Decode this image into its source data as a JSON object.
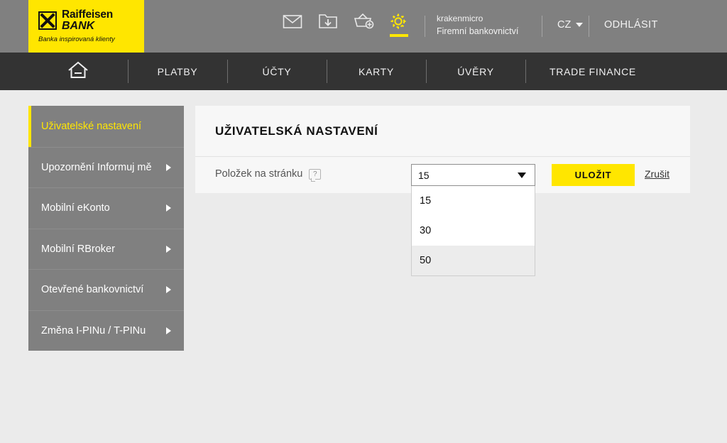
{
  "brand": {
    "logo_line1": "Raiffeisen",
    "logo_line2": "BANK",
    "tagline": "Banka inspirovaná klienty",
    "yellow": "#ffe600",
    "header_gray": "#808080",
    "nav_dark": "#333333",
    "page_bg": "#ebebeb"
  },
  "header": {
    "icons": [
      {
        "name": "mail-icon",
        "label": "Zprávy"
      },
      {
        "name": "download-folder-icon",
        "label": "Ke stažení"
      },
      {
        "name": "basket-add-icon",
        "label": "Koš"
      },
      {
        "name": "gear-icon",
        "label": "Nastavení",
        "active": true
      }
    ],
    "user_name": "krakenmicro",
    "user_segment": "Firemní bankovnictví",
    "language": "CZ",
    "logout": "ODHLÁSIT"
  },
  "nav": {
    "home_icon": "home-icon",
    "items": [
      {
        "label": "PLATBY"
      },
      {
        "label": "ÚČTY"
      },
      {
        "label": "KARTY"
      },
      {
        "label": "ÚVĚRY"
      },
      {
        "label": "TRADE FINANCE"
      }
    ]
  },
  "sidebar": {
    "items": [
      {
        "label": "Uživatelské nastavení",
        "active": true,
        "has_arrow": false
      },
      {
        "label": "Upozornění Informuj mě",
        "active": false,
        "has_arrow": true
      },
      {
        "label": "Mobilní eKonto",
        "active": false,
        "has_arrow": true
      },
      {
        "label": "Mobilní RBroker",
        "active": false,
        "has_arrow": true
      },
      {
        "label": "Otevřené bankovnictví",
        "active": false,
        "has_arrow": true
      },
      {
        "label": "Změna I-PINu / T-PINu",
        "active": false,
        "has_arrow": true
      }
    ]
  },
  "content": {
    "title": "UŽIVATELSKÁ NASTAVENÍ",
    "field_label": "Položek na stránku",
    "help_glyph": "?",
    "select": {
      "value": "15",
      "expanded": true,
      "options": [
        {
          "label": "15",
          "hovered": false
        },
        {
          "label": "30",
          "hovered": false
        },
        {
          "label": "50",
          "hovered": true
        }
      ]
    },
    "save_label": "ULOŽIT",
    "cancel_label": "Zrušit"
  }
}
